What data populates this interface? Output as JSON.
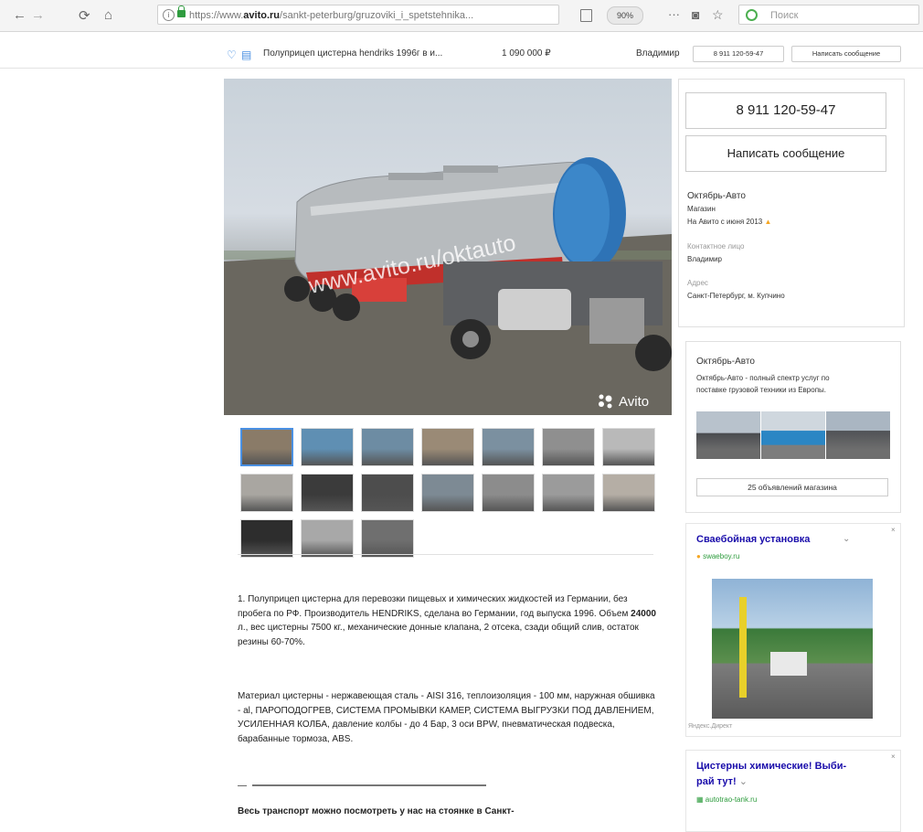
{
  "browser": {
    "url_prefix": "https://www.",
    "url_domain": "avito.ru",
    "url_path": "/sankt-peterburg/gruzoviki_i_spetstehnika...",
    "zoom": "90%",
    "search_placeholder": "Поиск"
  },
  "sticky": {
    "title": "Полуприцеп цистерна hendriks 1996г в и...",
    "price": "1 090 000 ₽",
    "seller": "Владимир",
    "phone_btn": "8 911 120-59-47",
    "message_btn": "Написать сообщение"
  },
  "photo": {
    "watermark": "www.avito.ru/oktauto",
    "brand": "Avito"
  },
  "thumb_colors": [
    "#8a7b68",
    "#5f8fb3",
    "#6d8ca3",
    "#9a8a76",
    "#7b90a0",
    "#8f8f8f",
    "#b9b9b9",
    "#a9a6a1",
    "#3b3b3b",
    "#4d4d4d",
    "#7d8a94",
    "#8c8c8c",
    "#9b9b9b",
    "#b5aea5",
    "#2d2d2d",
    "#a8a8a8",
    "#6f6f6f"
  ],
  "description": {
    "p1_start": "1. Полуприцеп цистерна для перевозки пищевых и химических жидкостей из Германии, без пробега по РФ. Производитель HENDRIKS, сделана во Германии, год выпуска 1996. Объем ",
    "p1_bold": "24000",
    "p1_end": " л., вес цистерны 7500 кг., механические донные клапана, 2 отсека, сзади общий слив, остаток резины 60-70%.",
    "p2": "Материал цистерны - нержавеющая сталь - AISI 316, теплоизоляция - 100 мм, наружная обшивка - al, ПАРОПОДОГРЕВ, СИСТЕМА ПРОМЫВКИ КАМЕР, СИСТЕМА ВЫГРУЗКИ ПОД ДАВЛЕНИЕМ, УСИЛЕННАЯ КОЛБА, давление колбы - до 4 Бар, 3 оси BPW, пневматическая подвеска, барабанные тормоза, ABS.",
    "dash": "—",
    "p3": "Весь транспорт можно посмотреть у нас на стоянке в Санкт-"
  },
  "seller_card": {
    "phone": "8 911 120-59-47",
    "message": "Написать сообщение",
    "company": "Октябрь-Авто",
    "type": "Магазин",
    "since": "На Авито с июня 2013",
    "contact_label": "Контактное лицо",
    "contact": "Владимир",
    "address_label": "Адрес",
    "address": "Санкт-Петербург, м. Купчино"
  },
  "shop_card": {
    "name": "Октябрь-Авто",
    "text1": "Октябрь-Авто - полный спектр услуг по",
    "text2": "поставке грузовой техники из Европы.",
    "button": "25 объявлений магазина"
  },
  "ad1": {
    "title": "Сваебойная установка",
    "domain": "swaeboy.ru",
    "label": "Яндекс.Директ"
  },
  "ad2": {
    "title1": "Цистерны химические! Выби-",
    "title2": "рай тут!",
    "domain": "autotrao-tank.ru"
  }
}
